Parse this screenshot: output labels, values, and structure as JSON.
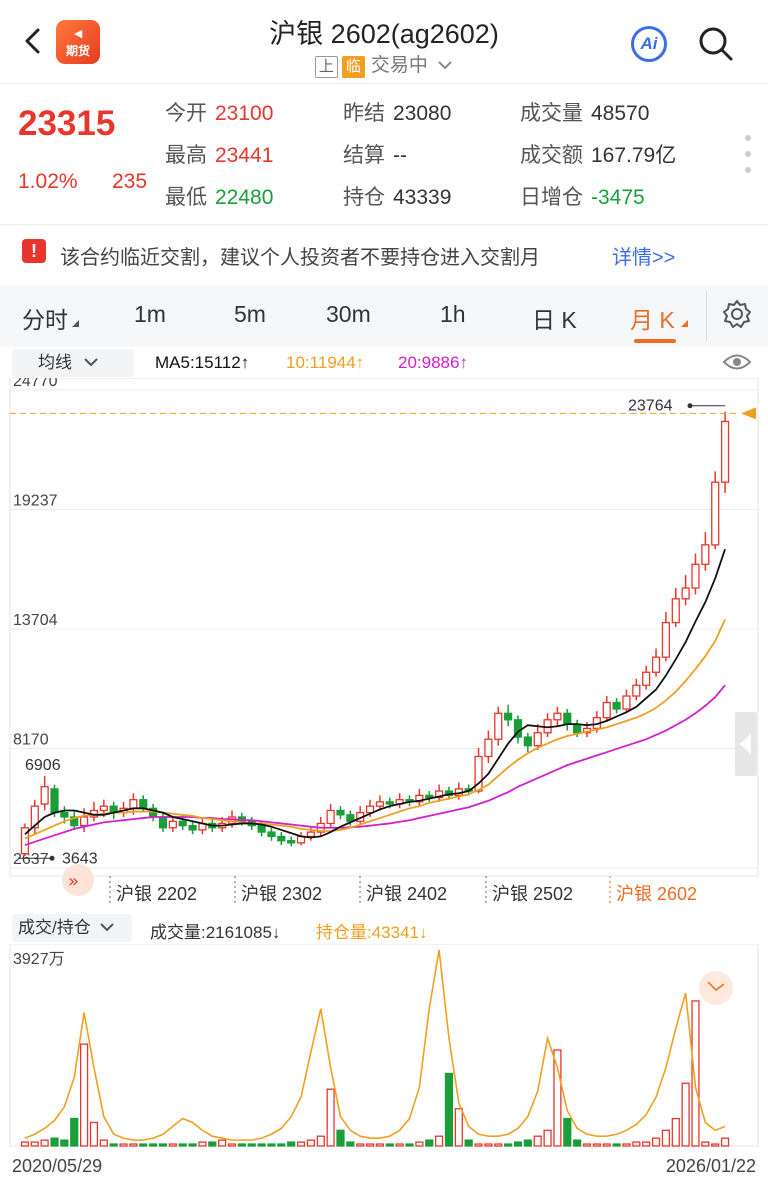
{
  "header": {
    "logo_top": "◄",
    "logo_text": "期货",
    "title": "沪银 2602(ag2602)",
    "exchange_tag": "上",
    "status_tag": "临",
    "status_text": "交易中",
    "ai_label": "Ai"
  },
  "quote": {
    "last_price": "23315",
    "change_pct": "1.02%",
    "change": "235",
    "fields": [
      {
        "key": "今开",
        "value": "23100",
        "color": "red"
      },
      {
        "key": "昨结",
        "value": "23080",
        "color": "normal"
      },
      {
        "key": "成交量",
        "value": "48570",
        "color": "normal"
      },
      {
        "key": "最高",
        "value": "23441",
        "color": "red"
      },
      {
        "key": "结算",
        "value": "--",
        "color": "normal"
      },
      {
        "key": "成交额",
        "value": "167.79亿",
        "color": "normal"
      },
      {
        "key": "最低",
        "value": "22480",
        "color": "green"
      },
      {
        "key": "持仓",
        "value": "43339",
        "color": "normal"
      },
      {
        "key": "日增仓",
        "value": "-3475",
        "color": "green"
      }
    ]
  },
  "notice": {
    "text": "该合约临近交割，建议个人投资者不要持仓进入交割月",
    "link": "详情>>"
  },
  "tabs": [
    "分时",
    "1m",
    "5m",
    "30m",
    "1h",
    "日 K",
    "月 K"
  ],
  "active_tab": "月 K",
  "ma_bar": {
    "selector": "均线",
    "ma5": "MA5:15112↑",
    "ma10": "10:11944↑",
    "ma20": "20:9886↑",
    "ma5_color": "#111111",
    "ma10_color": "#f0a020",
    "ma20_color": "#d020d0"
  },
  "chart_data": {
    "type": "candlestick",
    "y_ticks": [
      "24770",
      "19237",
      "13704",
      "8170",
      "2637"
    ],
    "ylim": [
      2637,
      24770
    ],
    "max_label": "23764",
    "min_label": "3643",
    "left_label": "6906",
    "contract_labels": [
      "沪银 2202",
      "沪银 2302",
      "沪银 2402",
      "沪银 2502",
      "沪银 2602"
    ],
    "candles": [
      [
        3300,
        4500,
        3200,
        4700
      ],
      [
        4500,
        5500,
        4200,
        5800
      ],
      [
        5600,
        6400,
        5300,
        6906
      ],
      [
        6300,
        5200,
        5000,
        6500
      ],
      [
        5200,
        5000,
        4700,
        5500
      ],
      [
        5000,
        4600,
        4400,
        5300
      ],
      [
        4600,
        5000,
        4300,
        5400
      ],
      [
        5000,
        5300,
        4800,
        5700
      ],
      [
        5300,
        5500,
        5000,
        5800
      ],
      [
        5500,
        5200,
        4900,
        5700
      ],
      [
        5200,
        5400,
        5000,
        5700
      ],
      [
        5400,
        5800,
        5100,
        6100
      ],
      [
        5800,
        5400,
        5200,
        6000
      ],
      [
        5400,
        5000,
        4800,
        5600
      ],
      [
        5000,
        4500,
        4300,
        5200
      ],
      [
        4500,
        4800,
        4300,
        5000
      ],
      [
        4800,
        4600,
        4400,
        5100
      ],
      [
        4600,
        4400,
        4200,
        4800
      ],
      [
        4400,
        4700,
        4200,
        4900
      ],
      [
        4700,
        4500,
        4300,
        4900
      ],
      [
        4500,
        4700,
        4300,
        5000
      ],
      [
        4700,
        5000,
        4500,
        5300
      ],
      [
        5000,
        4800,
        4600,
        5200
      ],
      [
        4800,
        4600,
        4400,
        5000
      ],
      [
        4600,
        4300,
        4100,
        4800
      ],
      [
        4300,
        4100,
        3900,
        4500
      ],
      [
        4100,
        3900,
        3700,
        4300
      ],
      [
        3900,
        3800,
        3643,
        4100
      ],
      [
        3800,
        4100,
        3700,
        4300
      ],
      [
        4100,
        4300,
        3900,
        4500
      ],
      [
        4300,
        4700,
        4100,
        5000
      ],
      [
        4700,
        5300,
        4500,
        5600
      ],
      [
        5300,
        5100,
        4900,
        5500
      ],
      [
        5100,
        4800,
        4600,
        5300
      ],
      [
        4800,
        5200,
        4700,
        5500
      ],
      [
        5200,
        5500,
        5000,
        5800
      ],
      [
        5500,
        5700,
        5300,
        6000
      ],
      [
        5700,
        5600,
        5400,
        5900
      ],
      [
        5600,
        5800,
        5400,
        6100
      ],
      [
        5800,
        5700,
        5500,
        6000
      ],
      [
        5700,
        6000,
        5500,
        6300
      ],
      [
        6000,
        5900,
        5700,
        6200
      ],
      [
        5900,
        6200,
        5700,
        6500
      ],
      [
        6200,
        6000,
        5800,
        6400
      ],
      [
        6000,
        6300,
        5800,
        6600
      ],
      [
        6300,
        6200,
        6000,
        6500
      ],
      [
        6200,
        7800,
        6100,
        8200
      ],
      [
        7800,
        8600,
        7500,
        9000
      ],
      [
        8600,
        9800,
        8300,
        10100
      ],
      [
        9800,
        9500,
        9200,
        10200
      ],
      [
        9500,
        8700,
        8400,
        9700
      ],
      [
        8700,
        8300,
        8000,
        8900
      ],
      [
        8300,
        8900,
        8100,
        9300
      ],
      [
        8900,
        9500,
        8700,
        9800
      ],
      [
        9500,
        9800,
        9200,
        10100
      ],
      [
        9800,
        9300,
        9000,
        10000
      ],
      [
        9300,
        8900,
        8700,
        9500
      ],
      [
        8900,
        9100,
        8700,
        9400
      ],
      [
        9100,
        9600,
        8900,
        9900
      ],
      [
        9600,
        10300,
        9400,
        10600
      ],
      [
        10300,
        10000,
        9800,
        10500
      ],
      [
        10000,
        10600,
        9800,
        10900
      ],
      [
        10600,
        11100,
        10400,
        11400
      ],
      [
        11100,
        11700,
        10900,
        12000
      ],
      [
        11700,
        12400,
        11500,
        12800
      ],
      [
        12400,
        14000,
        12200,
        14500
      ],
      [
        14000,
        15100,
        13800,
        15600
      ],
      [
        15100,
        15600,
        14800,
        16200
      ],
      [
        15600,
        16700,
        15300,
        17200
      ],
      [
        16700,
        17600,
        16400,
        18200
      ],
      [
        17600,
        20500,
        17400,
        21000
      ],
      [
        20500,
        23315,
        20000,
        23764
      ]
    ],
    "ma5": [
      4200,
      4600,
      5000,
      5200,
      5300,
      5300,
      5200,
      5100,
      5100,
      5200,
      5300,
      5400,
      5400,
      5300,
      5200,
      5000,
      4900,
      4800,
      4700,
      4600,
      4600,
      4650,
      4700,
      4700,
      4650,
      4550,
      4400,
      4250,
      4100,
      4050,
      4100,
      4300,
      4550,
      4750,
      4950,
      5150,
      5350,
      5500,
      5600,
      5700,
      5750,
      5850,
      5950,
      6050,
      6100,
      6200,
      6550,
      7000,
      7700,
      8400,
      8950,
      9250,
      9200,
      9150,
      9200,
      9300,
      9300,
      9250,
      9300,
      9450,
      9650,
      9850,
      10100,
      10500,
      10900,
      11550,
      12300,
      13100,
      14050,
      14950,
      16050,
      17400
    ],
    "ma10": [
      4000,
      4200,
      4400,
      4600,
      4800,
      4950,
      5050,
      5100,
      5150,
      5200,
      5200,
      5250,
      5250,
      5250,
      5200,
      5150,
      5100,
      5050,
      4950,
      4900,
      4850,
      4800,
      4750,
      4700,
      4700,
      4650,
      4600,
      4550,
      4450,
      4400,
      4350,
      4350,
      4400,
      4500,
      4650,
      4800,
      4950,
      5100,
      5250,
      5400,
      5500,
      5650,
      5750,
      5850,
      5950,
      6050,
      6250,
      6500,
      6900,
      7300,
      7650,
      7950,
      8200,
      8400,
      8600,
      8750,
      8850,
      8950,
      9050,
      9150,
      9300,
      9450,
      9600,
      9800,
      10050,
      10400,
      10800,
      11300,
      11850,
      12450,
      13150,
      14150
    ],
    "ma20": [
      3700,
      3850,
      4000,
      4150,
      4300,
      4450,
      4550,
      4650,
      4750,
      4800,
      4850,
      4900,
      4950,
      5000,
      5000,
      5000,
      5000,
      5000,
      4950,
      4950,
      4900,
      4900,
      4850,
      4850,
      4800,
      4750,
      4700,
      4650,
      4600,
      4550,
      4500,
      4500,
      4500,
      4520,
      4550,
      4600,
      4650,
      4700,
      4780,
      4850,
      4950,
      5050,
      5150,
      5250,
      5350,
      5450,
      5600,
      5750,
      5950,
      6150,
      6400,
      6600,
      6800,
      7000,
      7200,
      7400,
      7550,
      7700,
      7850,
      8000,
      8150,
      8300,
      8450,
      8600,
      8800,
      9000,
      9250,
      9500,
      9800,
      10150,
      10550,
      11100
    ]
  },
  "vol_bar": {
    "selector": "成交/持仓",
    "volume": "成交量:2161085↓",
    "open_interest": "持仓量:43341↓",
    "oi_color": "#f0a020"
  },
  "vol_chart": {
    "type": "bar",
    "y_top_label": "3927万",
    "volumes": [
      2,
      2,
      3,
      4,
      3,
      14,
      52,
      12,
      3,
      1,
      1,
      1,
      1,
      1,
      1,
      1,
      1,
      1,
      2,
      2,
      3,
      1,
      1,
      1,
      1,
      1,
      1,
      2,
      2,
      3,
      5,
      29,
      8,
      2,
      1,
      1,
      1,
      1,
      1,
      1,
      2,
      3,
      5,
      37,
      19,
      3,
      1,
      1,
      1,
      1,
      2,
      3,
      5,
      8,
      49,
      14,
      3,
      1,
      1,
      1,
      1,
      1,
      2,
      2,
      4,
      8,
      14,
      32,
      74,
      2,
      1,
      4
    ],
    "oi": [
      4,
      6,
      9,
      13,
      20,
      35,
      68,
      40,
      15,
      6,
      4,
      3,
      3,
      4,
      6,
      10,
      14,
      12,
      8,
      5,
      4,
      3,
      3,
      3,
      4,
      6,
      9,
      15,
      25,
      48,
      70,
      40,
      15,
      8,
      5,
      4,
      4,
      5,
      8,
      14,
      30,
      70,
      100,
      55,
      22,
      10,
      6,
      5,
      5,
      6,
      9,
      15,
      28,
      55,
      40,
      18,
      9,
      6,
      5,
      5,
      6,
      8,
      11,
      16,
      25,
      40,
      60,
      78,
      30,
      12,
      8,
      10
    ],
    "start_date": "2020/05/29",
    "end_date": "2026/01/22"
  }
}
